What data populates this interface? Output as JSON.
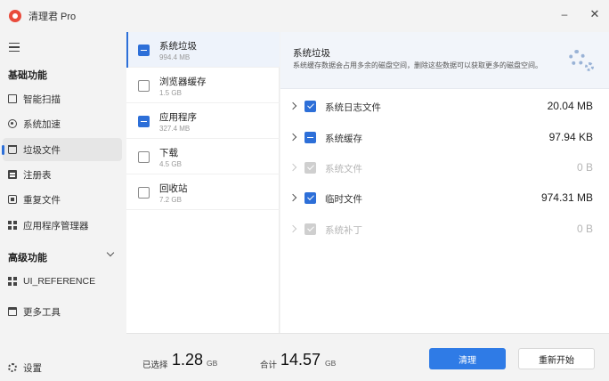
{
  "window": {
    "title": "清理君 Pro",
    "minimize_glyph": "–",
    "close_glyph": "✕"
  },
  "sidebar": {
    "basic_section": "基础功能",
    "advanced_section": "高级功能",
    "items": [
      {
        "label": "智能扫描",
        "icon": "scan-icon"
      },
      {
        "label": "系统加速",
        "icon": "speed-icon"
      },
      {
        "label": "垃圾文件",
        "icon": "trash-icon",
        "active": true
      },
      {
        "label": "注册表",
        "icon": "registry-icon"
      },
      {
        "label": "重复文件",
        "icon": "duplicate-icon"
      },
      {
        "label": "应用程序管理器",
        "icon": "grid-icon"
      }
    ],
    "advanced_items": [
      {
        "label": "UI_REFERENCE",
        "icon": "grid-icon"
      },
      {
        "label": "更多工具",
        "icon": "tools-icon"
      }
    ],
    "settings_label": "设置"
  },
  "categories": [
    {
      "name": "系统垃圾",
      "size": "994.4 MB",
      "state": "partial",
      "selected": true
    },
    {
      "name": "浏览器缓存",
      "size": "1.5 GB",
      "state": "unchecked"
    },
    {
      "name": "应用程序",
      "size": "327.4 MB",
      "state": "partial"
    },
    {
      "name": "下载",
      "size": "4.5 GB",
      "state": "unchecked"
    },
    {
      "name": "回收站",
      "size": "7.2 GB",
      "state": "unchecked"
    }
  ],
  "detail": {
    "title": "系统垃圾",
    "description": "系统缓存数据会占用多余的磁盘空间，删除这些数据可以获取更多的磁盘空间。",
    "rows": [
      {
        "name": "系统日志文件",
        "size": "20.04 MB",
        "state": "checked",
        "enabled": true
      },
      {
        "name": "系统缓存",
        "size": "97.94 KB",
        "state": "partial",
        "enabled": true
      },
      {
        "name": "系统文件",
        "size": "0 B",
        "state": "disabled",
        "enabled": false
      },
      {
        "name": "临时文件",
        "size": "974.31 MB",
        "state": "checked",
        "enabled": true
      },
      {
        "name": "系统补丁",
        "size": "0 B",
        "state": "disabled",
        "enabled": false
      }
    ]
  },
  "footer": {
    "selected_label": "已选择",
    "selected_value": "1.28",
    "selected_unit": "GB",
    "total_label": "合计",
    "total_value": "14.57",
    "total_unit": "GB",
    "clean_button": "清理",
    "restart_button": "重新开始"
  },
  "colors": {
    "accent": "#2f7be6",
    "logo": "#e94b3c"
  }
}
